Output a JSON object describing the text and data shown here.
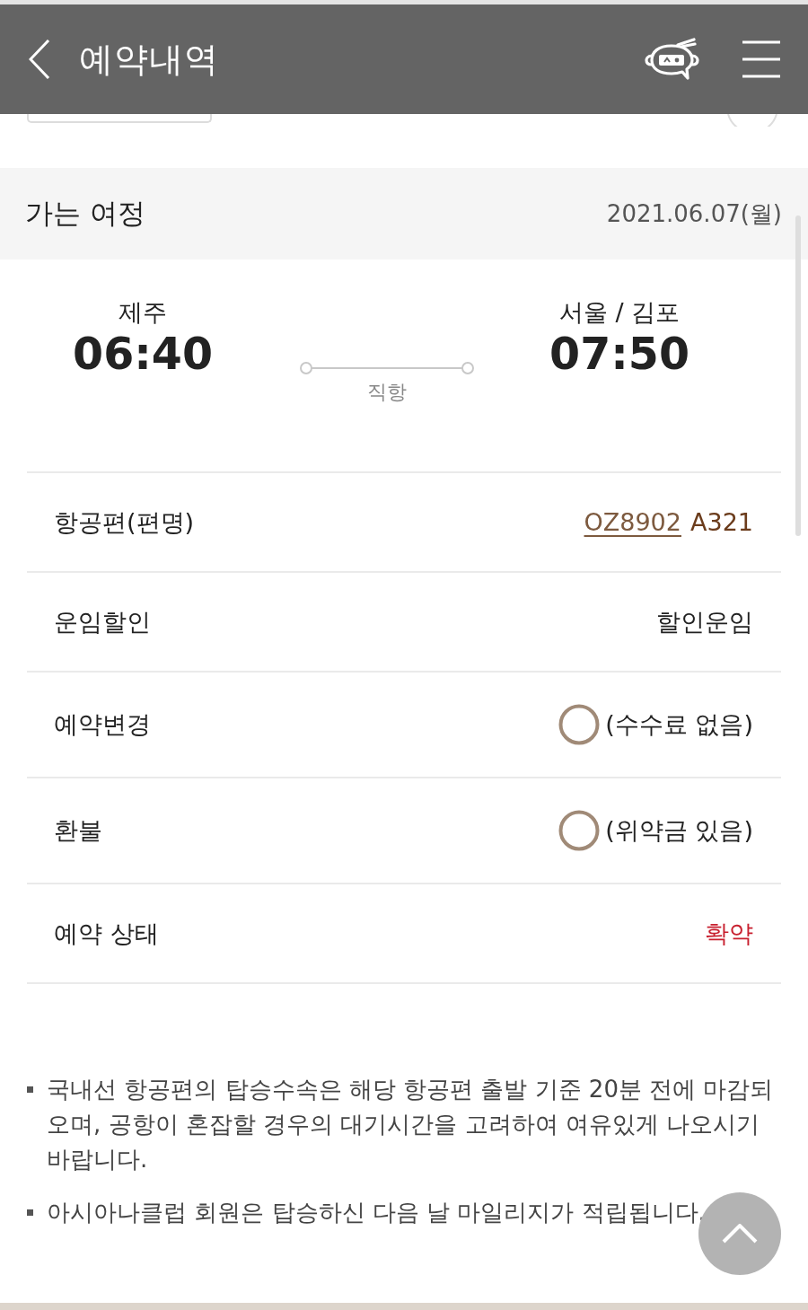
{
  "header": {
    "title": "예약내역"
  },
  "journey": {
    "title": "가는 여정",
    "date": "2021.06.07(월)",
    "departure": {
      "city": "제주",
      "time": "06:40"
    },
    "arrival": {
      "city": "서울 / 김포",
      "time": "07:50"
    },
    "route_type": "직항"
  },
  "details": [
    {
      "kind": "flight",
      "label": "항공편(편명)",
      "link": "OZ8902",
      "value": "A321"
    },
    {
      "kind": "text",
      "label": "운임할인",
      "value": "할인운임"
    },
    {
      "kind": "mark",
      "label": "예약변경",
      "value": "(수수료 없음)"
    },
    {
      "kind": "mark",
      "label": "환불",
      "value": "(위약금 있음)"
    },
    {
      "kind": "status",
      "label": "예약 상태",
      "value": "확약"
    }
  ],
  "notes": [
    "국내선 항공편의 탑승수속은 해당 항공편 출발 기준 20분 전에 마감되오며, 공항이 혼잡할 경우의 대기시간을 고려하여 여유있게 나오시기 바랍니다.",
    "아시아나클럽 회원은 탑승하신 다음 날 마일리지가 적립됩니다."
  ]
}
